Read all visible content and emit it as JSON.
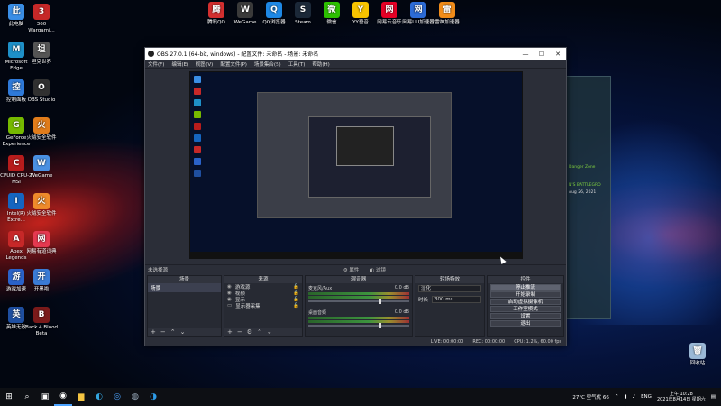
{
  "desktop": {
    "left_icons": [
      {
        "label": "此电脑",
        "icon": "computer-icon",
        "color": "#3a8ee6"
      },
      {
        "label": "360 Wargami...",
        "icon": "game-launcher-icon",
        "color": "#c62828"
      },
      {
        "label": "Microsoft Edge",
        "icon": "edge-icon",
        "color": "#1e90c8"
      },
      {
        "label": "坦克世界",
        "icon": "tank-icon",
        "color": "#555555"
      },
      {
        "label": "控制面板",
        "icon": "control-panel-icon",
        "color": "#2f7ad9"
      },
      {
        "label": "OBS Studio",
        "icon": "obs-icon",
        "color": "#303030"
      },
      {
        "label": "GeForce Experience",
        "icon": "nvidia-icon",
        "color": "#76b900"
      },
      {
        "label": "火绒安全软件",
        "icon": "shield-icon",
        "color": "#e07c1b"
      },
      {
        "label": "CPUID CPU-Z MSI",
        "icon": "cpuz-icon",
        "color": "#b71c1c"
      },
      {
        "label": "WeGame",
        "icon": "wegame-icon",
        "color": "#4a90e2"
      },
      {
        "label": "Intel(R) Extre...",
        "icon": "intel-icon",
        "color": "#1565c0"
      },
      {
        "label": "火绒安全软件",
        "icon": "huorong-icon",
        "color": "#ef8a2b"
      },
      {
        "label": "Apex Legends",
        "icon": "apex-icon",
        "color": "#c62828"
      },
      {
        "label": "网易有道词典",
        "icon": "dictionary-icon",
        "color": "#e53950"
      },
      {
        "label": "游戏加速",
        "icon": "booster-icon",
        "color": "#2a62c9"
      },
      {
        "label": "开黑啦",
        "icon": "chat-icon",
        "color": "#3a7bd5"
      },
      {
        "label": "英雄无敌",
        "icon": "battle-icon",
        "color": "#1f4fa0"
      },
      {
        "label": "Back 4 Blood Beta",
        "icon": "back4blood-icon",
        "color": "#7a1a1a"
      }
    ],
    "top_icons": [
      {
        "label": "腾讯QQ",
        "icon": "qq-icon",
        "color": "#d32f2f"
      },
      {
        "label": "WeGame",
        "icon": "wegame-icon",
        "color": "#3a3a3a"
      },
      {
        "label": "QQ浏览器",
        "icon": "qq-browser-icon",
        "color": "#1e88e5"
      },
      {
        "label": "Steam",
        "icon": "steam-icon",
        "color": "#1b2838"
      },
      {
        "label": "微信",
        "icon": "wechat-icon",
        "color": "#2dc100"
      },
      {
        "label": "YY语音",
        "icon": "yy-icon",
        "color": "#f7c300"
      },
      {
        "label": "网易云音乐",
        "icon": "music-icon",
        "color": "#e60026"
      },
      {
        "label": "网易UU加速器",
        "icon": "uu-icon",
        "color": "#2c6bd6"
      },
      {
        "label": "雷神加速器",
        "icon": "thunder-icon",
        "color": "#f08c1a"
      }
    ],
    "recycle_bin": {
      "label": "回收站",
      "icon": "recycle-bin-icon"
    }
  },
  "obs": {
    "title": "OBS 27.0.1 (64-bit, windows) - 配置文件: 未命名 - 场景: 未命名",
    "menu": [
      "文件(F)",
      "编辑(E)",
      "视图(V)",
      "配置文件(P)",
      "场景集合(S)",
      "工具(T)",
      "帮助(H)"
    ],
    "status_strip": {
      "no_source": "未选择源",
      "properties": "属性",
      "filters": "滤镜"
    },
    "docks": {
      "scenes": {
        "title": "场景",
        "items": [
          "场景"
        ]
      },
      "sources": {
        "title": "来源",
        "items": [
          "游戏源",
          "视频",
          "显示",
          "显示器采集"
        ]
      },
      "mixer": {
        "title": "混音器",
        "tracks": [
          {
            "name": "麦克风/Aux",
            "db": "0.0 dB"
          },
          {
            "name": "桌面音频",
            "db": "0.0 dB"
          }
        ]
      },
      "transitions": {
        "title": "转场特效",
        "type": "淡化",
        "duration_label": "时长",
        "duration": "300 ms"
      },
      "controls": {
        "title": "控件",
        "buttons": [
          "停止推流",
          "开始录制",
          "启动虚拟摄像机",
          "工作室模式",
          "设置",
          "退出"
        ]
      }
    },
    "statusbar": {
      "live": "LIVE: 00:00:00",
      "rec": "REC: 00:00:00",
      "cpu": "CPU: 1.2%, 60.00 fps"
    }
  },
  "bg_chat": {
    "lines": [
      "Danger Zone",
      "N'S BATTLEGRO",
      "Aug 26, 2021"
    ]
  },
  "taskbar": {
    "apps": [
      "start-icon",
      "search-icon",
      "task-view-icon",
      "edge-icon",
      "obs-icon",
      "folder-icon",
      "qq-browser-icon",
      "steam-icon",
      "obs-active-icon"
    ],
    "weather": "27°C 空气优 66",
    "lang": "ENG",
    "time": "上午 10:28",
    "date": "2021年8月14日 星期六"
  }
}
